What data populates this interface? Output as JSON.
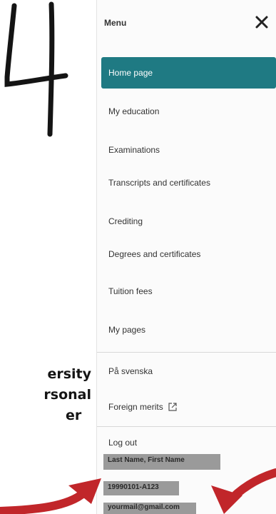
{
  "graphic": {
    "big_digit": "4",
    "partial_text": [
      "ersity",
      "rsonal",
      "er"
    ]
  },
  "menu": {
    "title": "Menu",
    "items": [
      {
        "label": "Home page",
        "active": true
      },
      {
        "label": "My education",
        "active": false
      },
      {
        "label": "Examinations",
        "active": false
      },
      {
        "label": "Transcripts and certificates",
        "active": false
      },
      {
        "label": "Crediting",
        "active": false
      },
      {
        "label": "Degrees and certificates",
        "active": false
      },
      {
        "label": "Tuition fees",
        "active": false
      },
      {
        "label": "My pages",
        "active": false
      }
    ],
    "secondary_items": [
      {
        "label": "På svenska"
      },
      {
        "label": "Foreign merits",
        "icon": "external-link-icon"
      },
      {
        "label": "Log out"
      }
    ]
  },
  "user": {
    "name": "Last Name, First Name",
    "personal_number": "19990101-A123",
    "email": "yourmail@gmail.com"
  },
  "colors": {
    "accent": "#1f7a83",
    "arrow": "#c1262a"
  }
}
